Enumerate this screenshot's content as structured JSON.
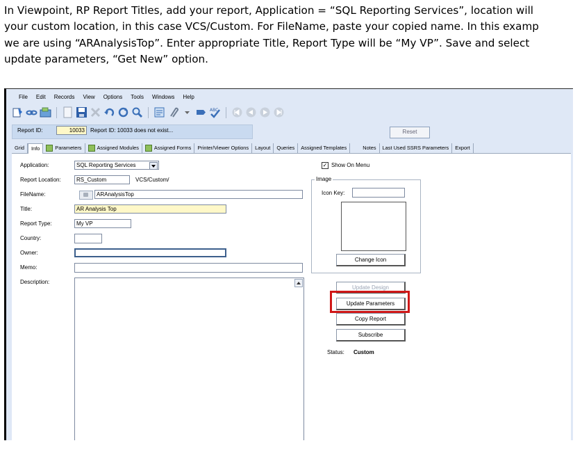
{
  "instructions": {
    "line1": "In Viewpoint, RP Report Titles, add your report, Application = “SQL Reporting Services”, location will",
    "line2": "your custom location, in this case VCS/Custom. For FileName, paste your copied name. In this examp",
    "line3": "we are using “ARAnalysisTop”. Enter appropriate Title, Report Type will be “My VP”. Save and select",
    "line4": "update parameters, “Get New” option."
  },
  "menu": [
    "File",
    "Edit",
    "Records",
    "View",
    "Options",
    "Tools",
    "Windows",
    "Help"
  ],
  "toolbar_icons": [
    "new-record-icon",
    "link-icon",
    "open-icon",
    "document-icon",
    "save-icon",
    "delete-icon",
    "undo-icon",
    "refresh-icon",
    "search-icon",
    "notes-icon",
    "attach-icon",
    "dropdown-arrow-icon",
    "next-icon",
    "spellcheck-icon",
    "first-record-icon",
    "previous-record-icon",
    "next-record-icon",
    "last-record-icon"
  ],
  "header": {
    "report_id_label": "Report ID:",
    "report_id_value": "10033",
    "status_message": "Report ID: 10033 does not exist...",
    "reset_label": "Reset"
  },
  "tabs": [
    "Grid",
    "Info",
    "Parameters",
    "Assigned Modules",
    "Assigned Forms",
    "Printer/Viewer Options",
    "Layout",
    "Queries",
    "Assigned Templates",
    "Notes",
    "Last Used SSRS Parameters",
    "Export"
  ],
  "form": {
    "application_label": "Application:",
    "application_value": "SQL Reporting Services",
    "location_label": "Report Location:",
    "location_value": "RS_Custom",
    "location_path": "VCS/Custom/",
    "filename_label": "FileName:",
    "filename_value": "ARAnalysisTop",
    "title_label": "Title:",
    "title_value": "AR Analysis Top",
    "report_type_label": "Report Type:",
    "report_type_value": "My VP",
    "country_label": "Country:",
    "country_value": "",
    "owner_label": "Owner:",
    "owner_value": "",
    "memo_label": "Memo:",
    "memo_value": "",
    "description_label": "Description:",
    "description_value": ""
  },
  "side": {
    "show_on_menu_label": "Show On Menu",
    "show_on_menu_checked": true,
    "image_group_title": "Image",
    "icon_key_label": "Icon Key:",
    "icon_key_value": "",
    "change_icon_label": "Change Icon",
    "update_design_label": "Update Design",
    "update_parameters_label": "Update Parameters",
    "copy_report_label": "Copy Report",
    "subscribe_label": "Subscribe",
    "status_label": "Status:",
    "status_value": "Custom"
  },
  "colors": {
    "highlight": "#d01818",
    "app_background": "#dfe8f6",
    "yellow_field": "#fff8c8"
  }
}
